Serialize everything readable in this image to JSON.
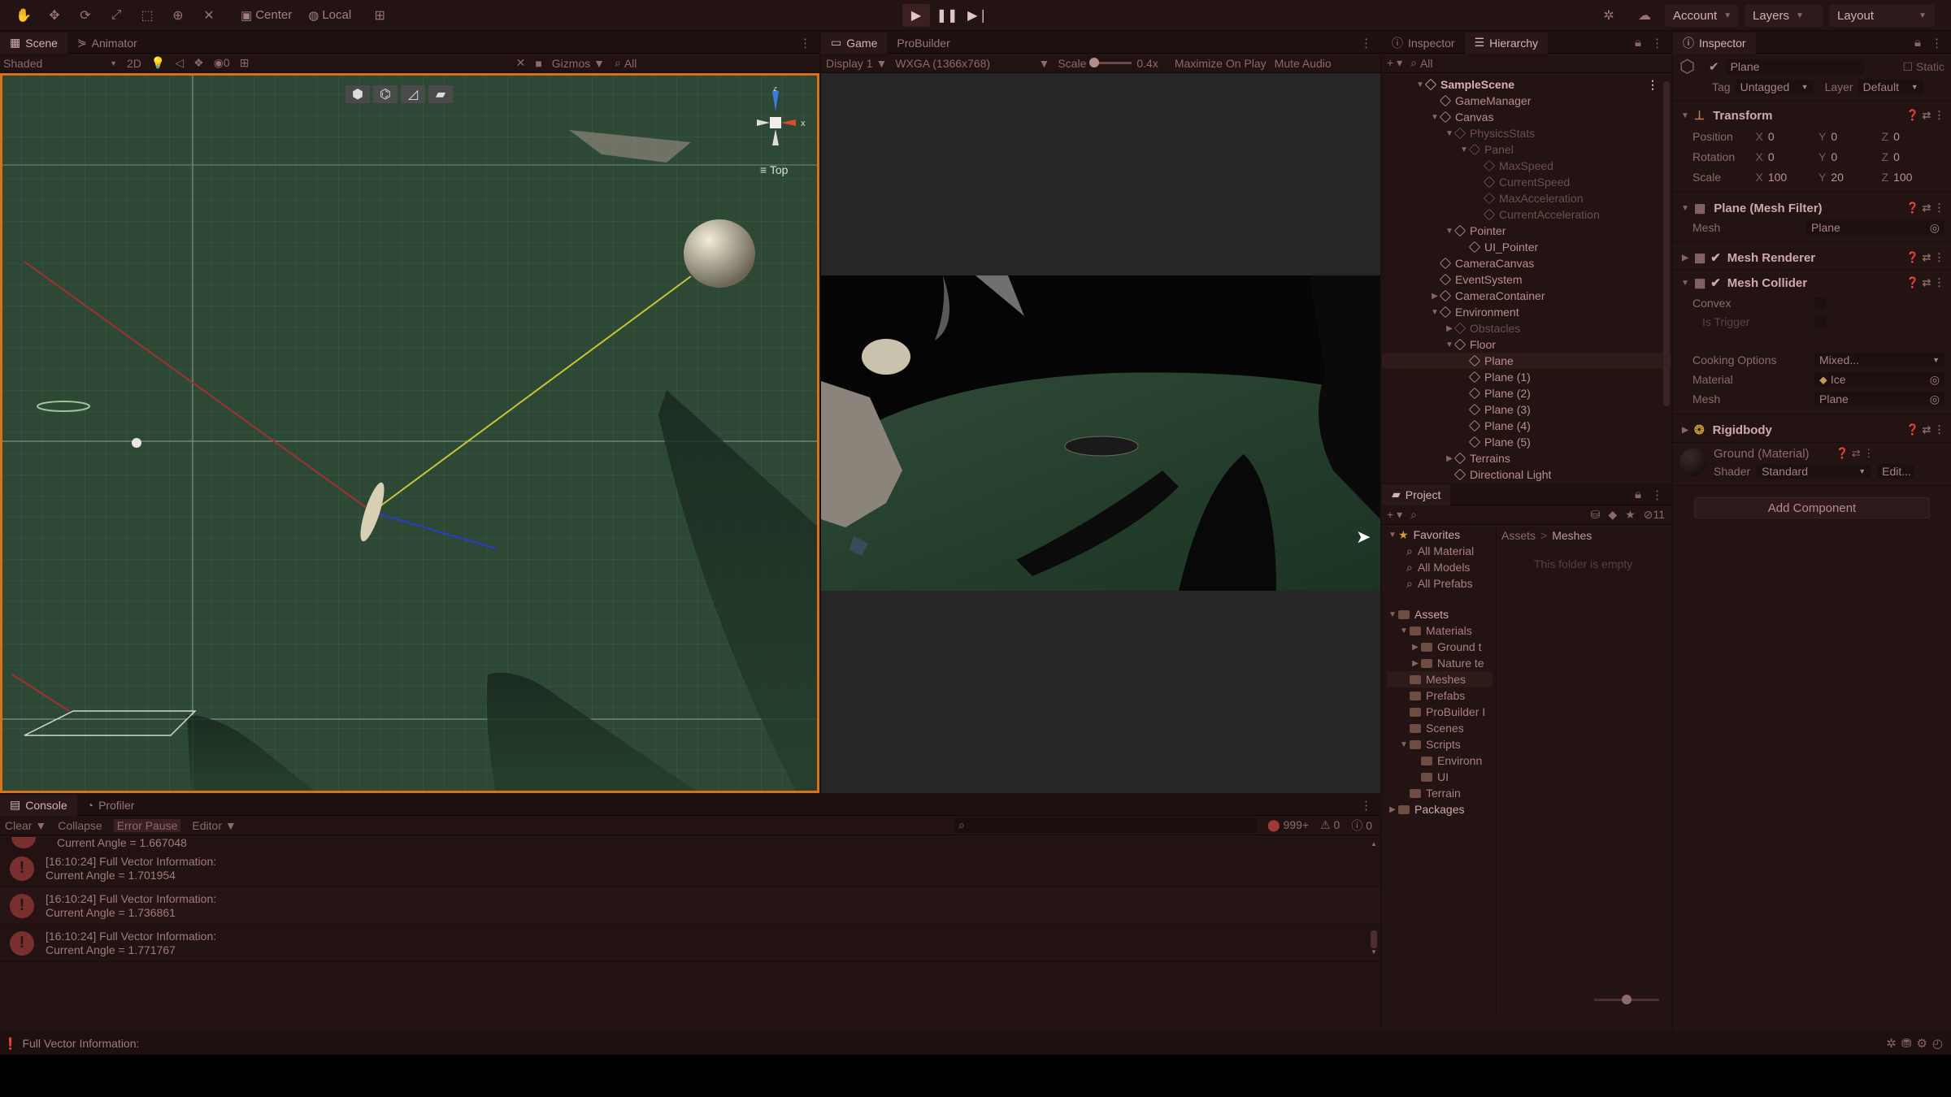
{
  "toolbar": {
    "pivot": "Center",
    "space": "Local",
    "account": "Account",
    "layers": "Layers",
    "layout": "Layout"
  },
  "scene": {
    "tab_scene": "Scene",
    "tab_animator": "Animator",
    "shading": "Shaded",
    "mode_2d": "2D",
    "gizmos": "Gizmos",
    "search_placeholder": "All",
    "orient_label": "Top",
    "hidden_count": "0"
  },
  "game": {
    "tab_game": "Game",
    "tab_probuilder": "ProBuilder",
    "display": "Display 1",
    "resolution": "WXGA (1366x768)",
    "scale_label": "Scale",
    "scale_value": "0.4x",
    "maximize": "Maximize On Play",
    "mute": "Mute Audio"
  },
  "hierarchy": {
    "tab_inspector": "Inspector",
    "tab_hierarchy": "Hierarchy",
    "search_placeholder": "All",
    "items": [
      {
        "label": "SampleScene",
        "depth": 0,
        "arrow": "▼",
        "style": "scene"
      },
      {
        "label": "GameManager",
        "depth": 1,
        "arrow": "",
        "style": ""
      },
      {
        "label": "Canvas",
        "depth": 1,
        "arrow": "▼",
        "style": ""
      },
      {
        "label": "PhysicsStats",
        "depth": 2,
        "arrow": "▼",
        "style": "dim"
      },
      {
        "label": "Panel",
        "depth": 3,
        "arrow": "▼",
        "style": "dim"
      },
      {
        "label": "MaxSpeed",
        "depth": 4,
        "arrow": "",
        "style": "dim"
      },
      {
        "label": "CurrentSpeed",
        "depth": 4,
        "arrow": "",
        "style": "dim"
      },
      {
        "label": "MaxAcceleration",
        "depth": 4,
        "arrow": "",
        "style": "dim"
      },
      {
        "label": "CurrentAcceleration",
        "depth": 4,
        "arrow": "",
        "style": "dim"
      },
      {
        "label": "Pointer",
        "depth": 2,
        "arrow": "▼",
        "style": ""
      },
      {
        "label": "UI_Pointer",
        "depth": 3,
        "arrow": "",
        "style": ""
      },
      {
        "label": "CameraCanvas",
        "depth": 1,
        "arrow": "",
        "style": ""
      },
      {
        "label": "EventSystem",
        "depth": 1,
        "arrow": "",
        "style": ""
      },
      {
        "label": "CameraContainer",
        "depth": 1,
        "arrow": "▶",
        "style": ""
      },
      {
        "label": "Environment",
        "depth": 1,
        "arrow": "▼",
        "style": ""
      },
      {
        "label": "Obstacles",
        "depth": 2,
        "arrow": "▶",
        "style": "dim"
      },
      {
        "label": "Floor",
        "depth": 2,
        "arrow": "▼",
        "style": ""
      },
      {
        "label": "Plane",
        "depth": 3,
        "arrow": "",
        "style": "sel"
      },
      {
        "label": "Plane (1)",
        "depth": 3,
        "arrow": "",
        "style": ""
      },
      {
        "label": "Plane (2)",
        "depth": 3,
        "arrow": "",
        "style": ""
      },
      {
        "label": "Plane (3)",
        "depth": 3,
        "arrow": "",
        "style": ""
      },
      {
        "label": "Plane (4)",
        "depth": 3,
        "arrow": "",
        "style": ""
      },
      {
        "label": "Plane (5)",
        "depth": 3,
        "arrow": "",
        "style": ""
      },
      {
        "label": "Terrains",
        "depth": 2,
        "arrow": "▶",
        "style": ""
      },
      {
        "label": "Directional Light",
        "depth": 2,
        "arrow": "",
        "style": ""
      }
    ]
  },
  "project": {
    "tab": "Project",
    "hidden_count": "11",
    "favorites": "Favorites",
    "fav_items": [
      "All Material",
      "All Models",
      "All Prefabs"
    ],
    "assets": "Assets",
    "tree": [
      {
        "label": "Materials",
        "depth": 1,
        "arrow": "▼"
      },
      {
        "label": "Ground t",
        "depth": 2,
        "arrow": "▶"
      },
      {
        "label": "Nature te",
        "depth": 2,
        "arrow": "▶"
      },
      {
        "label": "Meshes",
        "depth": 1,
        "arrow": ""
      },
      {
        "label": "Prefabs",
        "depth": 1,
        "arrow": ""
      },
      {
        "label": "ProBuilder I",
        "depth": 1,
        "arrow": ""
      },
      {
        "label": "Scenes",
        "depth": 1,
        "arrow": ""
      },
      {
        "label": "Scripts",
        "depth": 1,
        "arrow": "▼"
      },
      {
        "label": "Environn",
        "depth": 2,
        "arrow": ""
      },
      {
        "label": "UI",
        "depth": 2,
        "arrow": ""
      },
      {
        "label": "Terrain",
        "depth": 1,
        "arrow": ""
      }
    ],
    "packages": "Packages",
    "breadcrumb_root": "Assets",
    "breadcrumb_sep": ">",
    "breadcrumb_leaf": "Meshes",
    "empty_msg": "This folder is empty"
  },
  "inspector": {
    "tab": "Inspector",
    "object_name": "Plane",
    "static_label": "Static",
    "tag_label": "Tag",
    "tag_value": "Untagged",
    "layer_label": "Layer",
    "layer_value": "Default",
    "transform": {
      "title": "Transform",
      "position_label": "Position",
      "rotation_label": "Rotation",
      "scale_label": "Scale",
      "position": {
        "x": "0",
        "y": "0",
        "z": "0"
      },
      "rotation": {
        "x": "0",
        "y": "0",
        "z": "0"
      },
      "scale": {
        "x": "100",
        "y": "20",
        "z": "100"
      }
    },
    "mesh_filter": {
      "title": "Plane (Mesh Filter)",
      "mesh_label": "Mesh",
      "mesh_value": "Plane"
    },
    "mesh_renderer": {
      "title": "Mesh Renderer"
    },
    "mesh_collider": {
      "title": "Mesh Collider",
      "convex_label": "Convex",
      "trigger_label": "Is Trigger",
      "cooking_label": "Cooking Options",
      "cooking_value": "Mixed...",
      "material_label": "Material",
      "material_value": "Ice",
      "mesh_label": "Mesh",
      "mesh_value": "Plane"
    },
    "rigidbody": {
      "title": "Rigidbody"
    },
    "material": {
      "name": "Ground (Material)",
      "shader_label": "Shader",
      "shader_value": "Standard",
      "edit": "Edit..."
    },
    "add_component": "Add Component"
  },
  "console": {
    "tab_console": "Console",
    "tab_profiler": "Profiler",
    "clear": "Clear",
    "collapse": "Collapse",
    "error_pause": "Error Pause",
    "editor": "Editor",
    "error_count": "999+",
    "warn_count": "0",
    "msg_count": "0",
    "partial_line": "Current Angle = 1.667048",
    "logs": [
      {
        "line1": "[16:10:24] Full Vector Information:",
        "line2": "Current Angle = 1.701954"
      },
      {
        "line1": "[16:10:24] Full Vector Information:",
        "line2": "Current Angle = 1.736861"
      },
      {
        "line1": "[16:10:24] Full Vector Information:",
        "line2": "Current Angle = 1.771767"
      }
    ]
  },
  "statusbar": {
    "message": "Full Vector Information:"
  },
  "colors": {
    "accent_orange": "#e3781f",
    "scene_green": "#2e4a37",
    "bg_dark": "#1b0f0f"
  }
}
